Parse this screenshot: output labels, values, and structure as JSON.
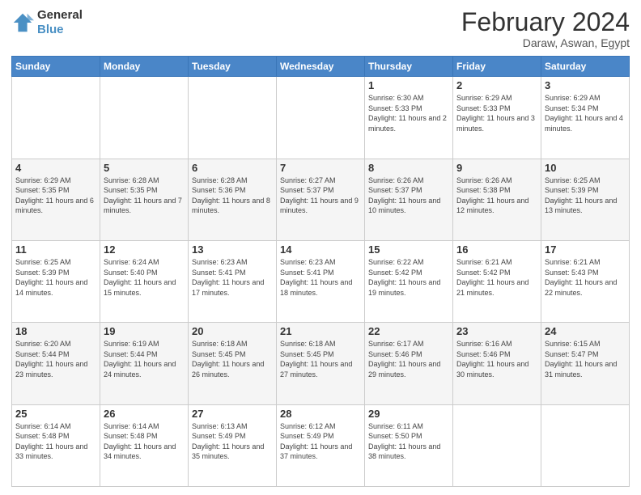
{
  "header": {
    "logo_line1": "General",
    "logo_line2": "Blue",
    "title": "February 2024",
    "subtitle": "Daraw, Aswan, Egypt"
  },
  "days_of_week": [
    "Sunday",
    "Monday",
    "Tuesday",
    "Wednesday",
    "Thursday",
    "Friday",
    "Saturday"
  ],
  "weeks": [
    [
      {
        "day": "",
        "info": ""
      },
      {
        "day": "",
        "info": ""
      },
      {
        "day": "",
        "info": ""
      },
      {
        "day": "",
        "info": ""
      },
      {
        "day": "1",
        "info": "Sunrise: 6:30 AM\nSunset: 5:33 PM\nDaylight: 11 hours and 2 minutes."
      },
      {
        "day": "2",
        "info": "Sunrise: 6:29 AM\nSunset: 5:33 PM\nDaylight: 11 hours and 3 minutes."
      },
      {
        "day": "3",
        "info": "Sunrise: 6:29 AM\nSunset: 5:34 PM\nDaylight: 11 hours and 4 minutes."
      }
    ],
    [
      {
        "day": "4",
        "info": "Sunrise: 6:29 AM\nSunset: 5:35 PM\nDaylight: 11 hours and 6 minutes."
      },
      {
        "day": "5",
        "info": "Sunrise: 6:28 AM\nSunset: 5:35 PM\nDaylight: 11 hours and 7 minutes."
      },
      {
        "day": "6",
        "info": "Sunrise: 6:28 AM\nSunset: 5:36 PM\nDaylight: 11 hours and 8 minutes."
      },
      {
        "day": "7",
        "info": "Sunrise: 6:27 AM\nSunset: 5:37 PM\nDaylight: 11 hours and 9 minutes."
      },
      {
        "day": "8",
        "info": "Sunrise: 6:26 AM\nSunset: 5:37 PM\nDaylight: 11 hours and 10 minutes."
      },
      {
        "day": "9",
        "info": "Sunrise: 6:26 AM\nSunset: 5:38 PM\nDaylight: 11 hours and 12 minutes."
      },
      {
        "day": "10",
        "info": "Sunrise: 6:25 AM\nSunset: 5:39 PM\nDaylight: 11 hours and 13 minutes."
      }
    ],
    [
      {
        "day": "11",
        "info": "Sunrise: 6:25 AM\nSunset: 5:39 PM\nDaylight: 11 hours and 14 minutes."
      },
      {
        "day": "12",
        "info": "Sunrise: 6:24 AM\nSunset: 5:40 PM\nDaylight: 11 hours and 15 minutes."
      },
      {
        "day": "13",
        "info": "Sunrise: 6:23 AM\nSunset: 5:41 PM\nDaylight: 11 hours and 17 minutes."
      },
      {
        "day": "14",
        "info": "Sunrise: 6:23 AM\nSunset: 5:41 PM\nDaylight: 11 hours and 18 minutes."
      },
      {
        "day": "15",
        "info": "Sunrise: 6:22 AM\nSunset: 5:42 PM\nDaylight: 11 hours and 19 minutes."
      },
      {
        "day": "16",
        "info": "Sunrise: 6:21 AM\nSunset: 5:42 PM\nDaylight: 11 hours and 21 minutes."
      },
      {
        "day": "17",
        "info": "Sunrise: 6:21 AM\nSunset: 5:43 PM\nDaylight: 11 hours and 22 minutes."
      }
    ],
    [
      {
        "day": "18",
        "info": "Sunrise: 6:20 AM\nSunset: 5:44 PM\nDaylight: 11 hours and 23 minutes."
      },
      {
        "day": "19",
        "info": "Sunrise: 6:19 AM\nSunset: 5:44 PM\nDaylight: 11 hours and 24 minutes."
      },
      {
        "day": "20",
        "info": "Sunrise: 6:18 AM\nSunset: 5:45 PM\nDaylight: 11 hours and 26 minutes."
      },
      {
        "day": "21",
        "info": "Sunrise: 6:18 AM\nSunset: 5:45 PM\nDaylight: 11 hours and 27 minutes."
      },
      {
        "day": "22",
        "info": "Sunrise: 6:17 AM\nSunset: 5:46 PM\nDaylight: 11 hours and 29 minutes."
      },
      {
        "day": "23",
        "info": "Sunrise: 6:16 AM\nSunset: 5:46 PM\nDaylight: 11 hours and 30 minutes."
      },
      {
        "day": "24",
        "info": "Sunrise: 6:15 AM\nSunset: 5:47 PM\nDaylight: 11 hours and 31 minutes."
      }
    ],
    [
      {
        "day": "25",
        "info": "Sunrise: 6:14 AM\nSunset: 5:48 PM\nDaylight: 11 hours and 33 minutes."
      },
      {
        "day": "26",
        "info": "Sunrise: 6:14 AM\nSunset: 5:48 PM\nDaylight: 11 hours and 34 minutes."
      },
      {
        "day": "27",
        "info": "Sunrise: 6:13 AM\nSunset: 5:49 PM\nDaylight: 11 hours and 35 minutes."
      },
      {
        "day": "28",
        "info": "Sunrise: 6:12 AM\nSunset: 5:49 PM\nDaylight: 11 hours and 37 minutes."
      },
      {
        "day": "29",
        "info": "Sunrise: 6:11 AM\nSunset: 5:50 PM\nDaylight: 11 hours and 38 minutes."
      },
      {
        "day": "",
        "info": ""
      },
      {
        "day": "",
        "info": ""
      }
    ]
  ]
}
